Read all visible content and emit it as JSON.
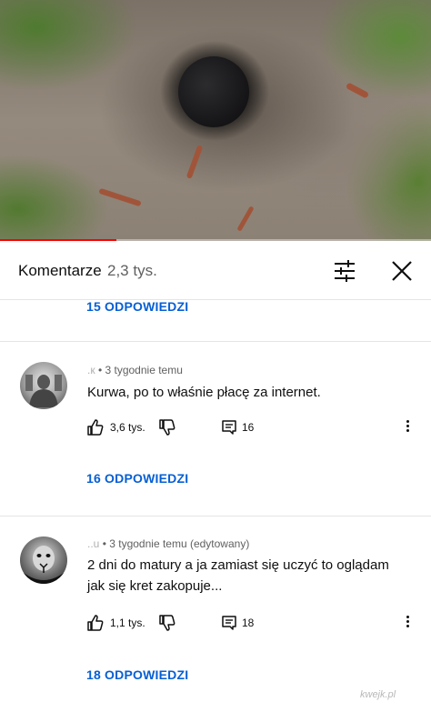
{
  "video": {
    "progress_fraction": 0.27
  },
  "header": {
    "title": "Komentarze",
    "count": "2,3 tys."
  },
  "thread_top": {
    "replies_label": "15 ODPOWIEDZI"
  },
  "comments": [
    {
      "author": ".к",
      "time": "3 tygodnie temu",
      "text_lines": [
        "Kurwa, po to właśnie płacę za internet."
      ],
      "likes": "3,6 tys.",
      "reply_count": "16",
      "replies_label": "16 ODPOWIEDZI"
    },
    {
      "author": "..u",
      "time": "3 tygodnie temu (edytowany)",
      "text_lines": [
        "2 dni do matury a ja zamiast się uczyć to oglądam",
        "jak się kret zakopuje..."
      ],
      "likes": "1,1 tys.",
      "reply_count": "18",
      "replies_label": "18 ODPOWIEDZI"
    }
  ],
  "watermark": "kwejk.pl",
  "icons": {
    "filter": "filter-icon",
    "close": "close-icon",
    "like": "thumbs-up-icon",
    "dislike": "thumbs-down-icon",
    "reply": "comment-icon",
    "more": "more-vertical-icon"
  },
  "colors": {
    "accent_blue": "#065fd4",
    "progress_red": "#ff0000"
  }
}
